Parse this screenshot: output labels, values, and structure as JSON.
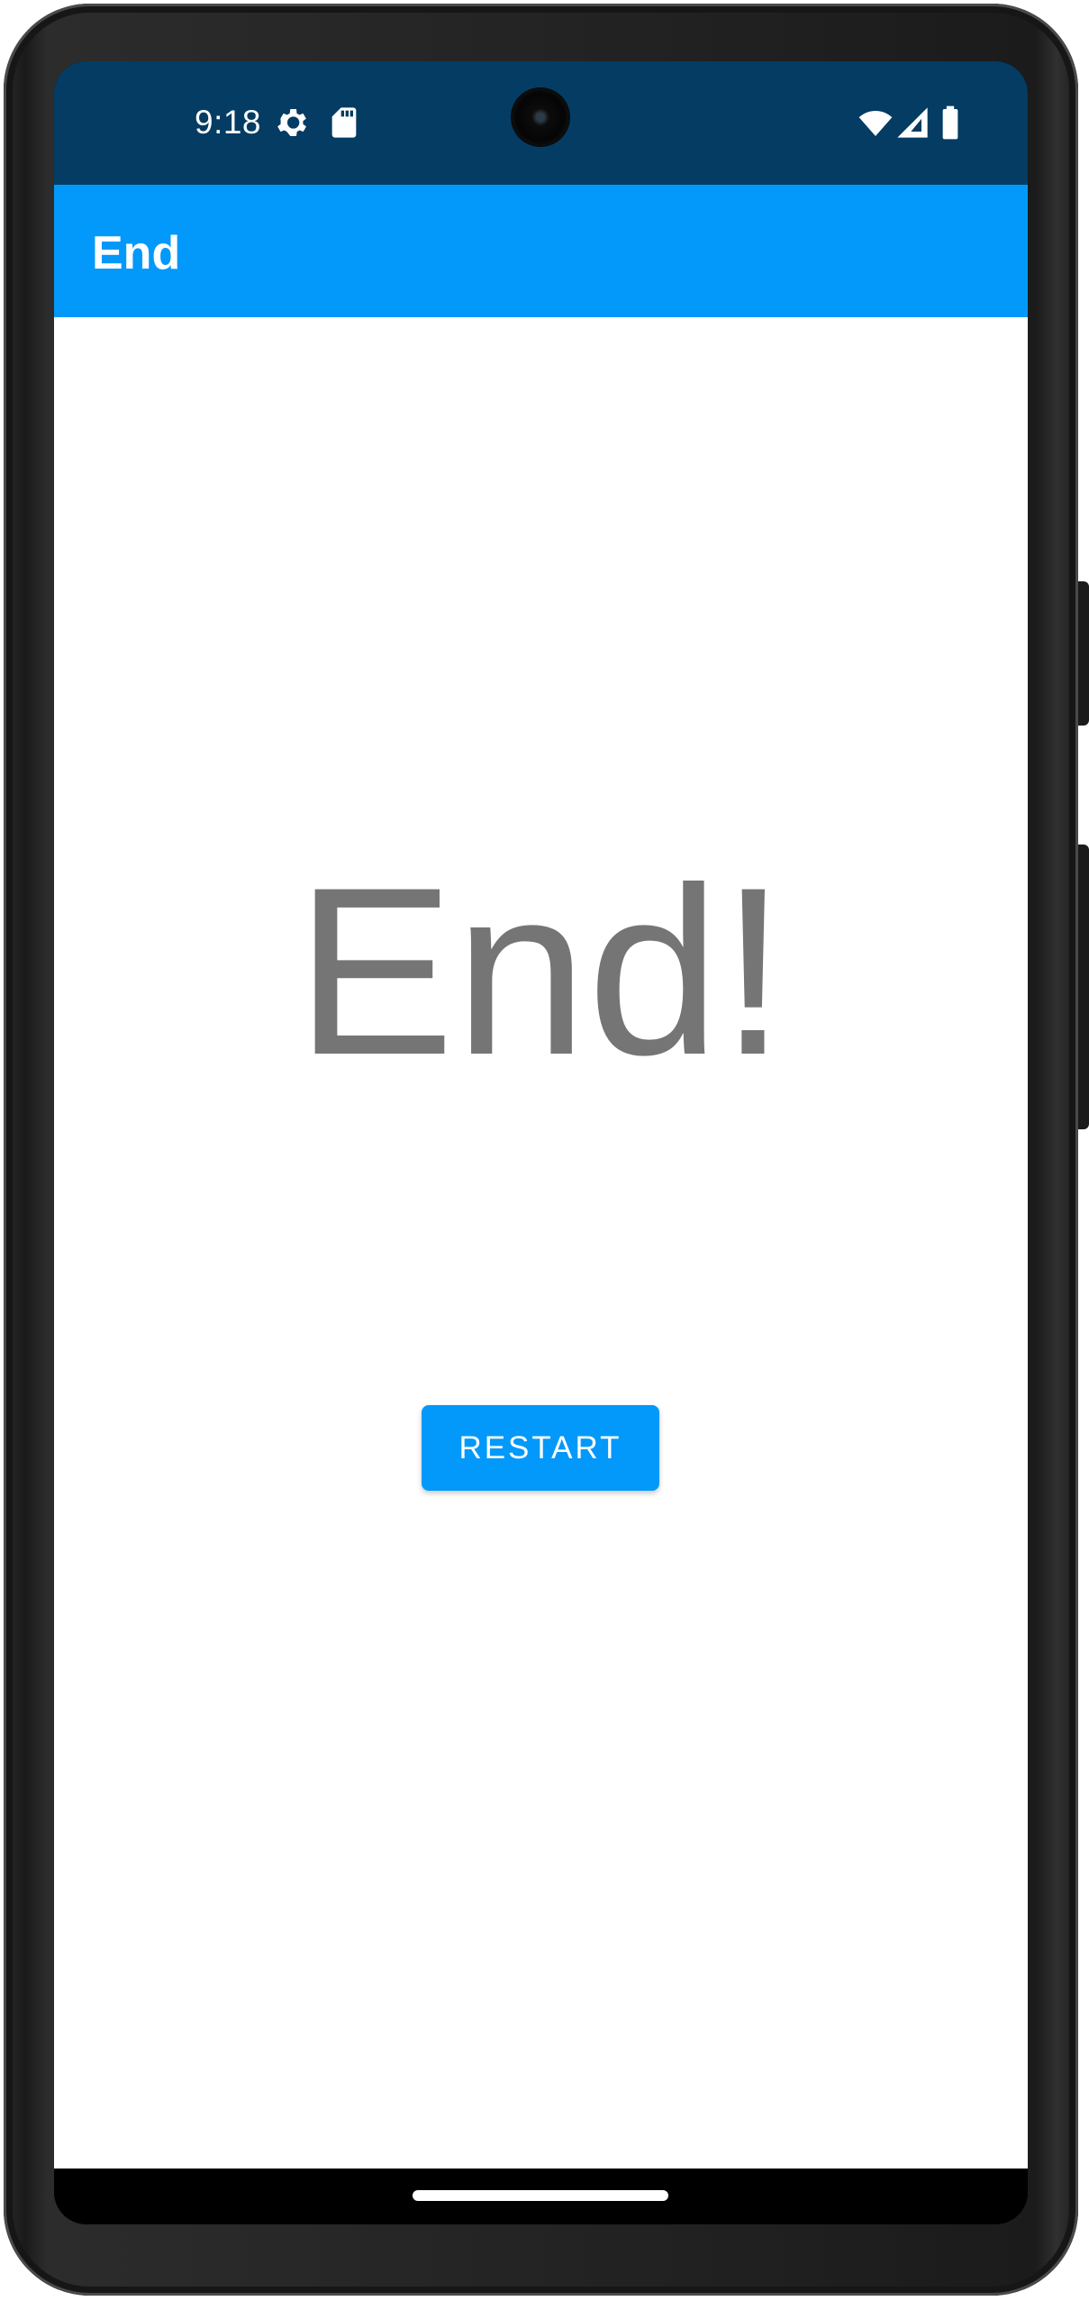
{
  "status_bar": {
    "time": "9:18",
    "icons": [
      "settings-icon",
      "sd-card-icon",
      "wifi-icon",
      "cellular-signal-icon",
      "battery-icon"
    ],
    "background_color": "#043c63"
  },
  "app_bar": {
    "title": "End",
    "background_color": "#0399fb"
  },
  "main": {
    "message": "End!",
    "message_color": "#757575",
    "restart_button": {
      "label": "RESTART",
      "color": "#0399fb"
    }
  },
  "navigation": {
    "home_indicator": "home-indicator"
  }
}
